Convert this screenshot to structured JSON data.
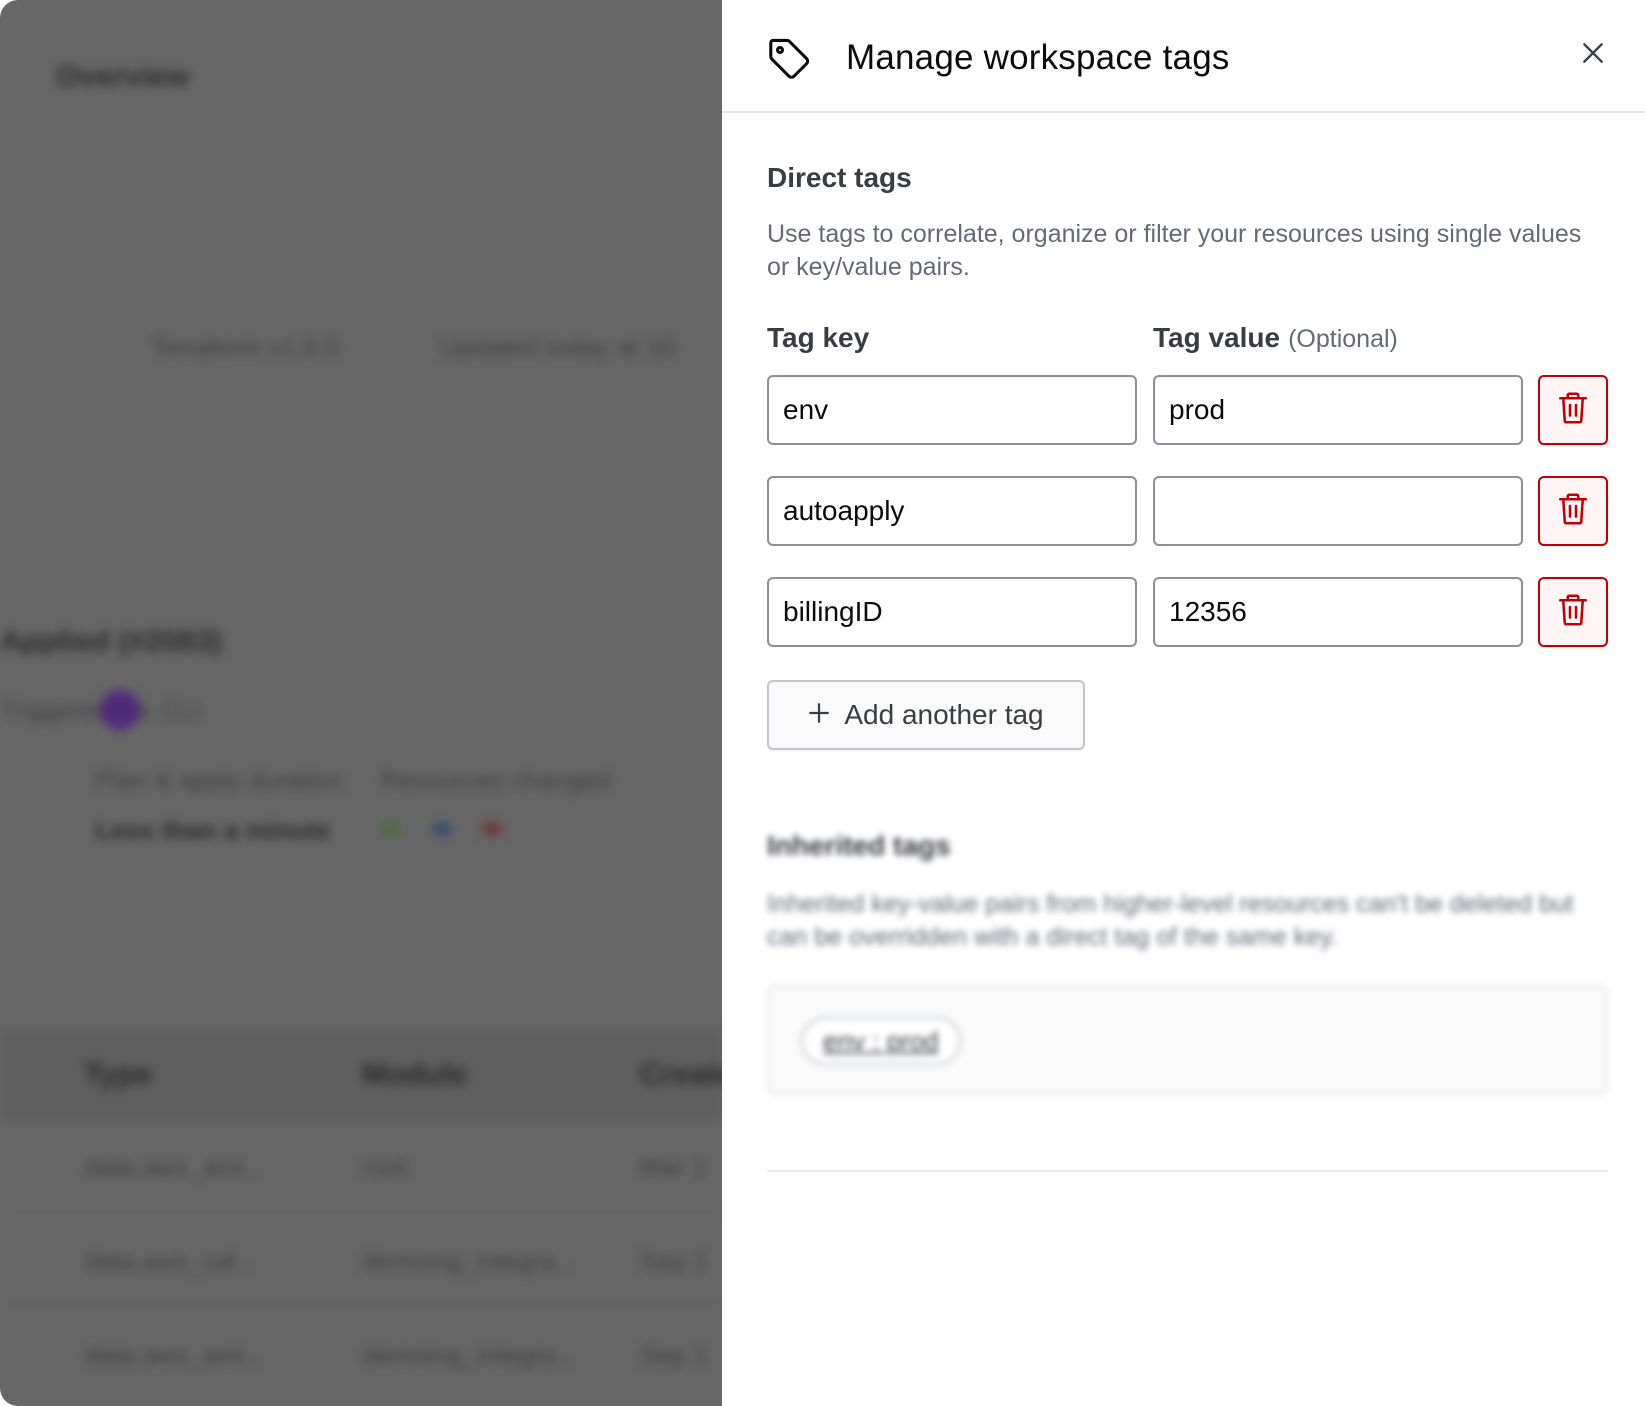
{
  "background": {
    "breadcrumb": "Overview",
    "meta_items": [
      "Terraform v1.8.0",
      "Updated today at 10:"
    ],
    "run_title": "Applied (#2083)",
    "run_info": "Triggered via",
    "run_user": "CLI",
    "stats_labels": [
      "Plan & apply duration",
      "Resources changed"
    ],
    "duration_value": "Less than a minute",
    "table_headers": [
      "Type",
      "Module",
      "Created"
    ],
    "table_rows": [
      [
        "data.aws_ami...",
        "root",
        "Mar 1"
      ],
      [
        "data.aws_cal...",
        "demoing_integra...",
        "Sep 1"
      ],
      [
        "data.aws_ami...",
        "demoing_integra...",
        "Sep 1"
      ]
    ]
  },
  "panel": {
    "title": "Manage workspace tags",
    "header_icon": "tag-icon",
    "close_icon": "close-icon",
    "direct": {
      "title": "Direct tags",
      "description": "Use tags to correlate, organize or filter your resources using single values or key/value pairs.",
      "key_label": "Tag key",
      "value_label": "Tag value",
      "optional_label": "(Optional)",
      "tags": [
        {
          "key": "env",
          "value": "prod"
        },
        {
          "key": "autoapply",
          "value": ""
        },
        {
          "key": "billingID",
          "value": "12356"
        }
      ],
      "delete_icon": "trash-icon",
      "add_label": "Add another tag",
      "add_icon": "plus-icon"
    },
    "inherited": {
      "title": "Inherited tags",
      "description": "Inherited key-value pairs from higher-level resources can't be deleted but can be overridden with a direct tag of the same key.",
      "tags": [
        "env : prod"
      ]
    }
  },
  "colors": {
    "danger": "#c00005",
    "danger_bg": "#fff5f5",
    "overlay": "#676767",
    "text_primary": "#0c0c0e",
    "text_secondary": "#656a76"
  }
}
